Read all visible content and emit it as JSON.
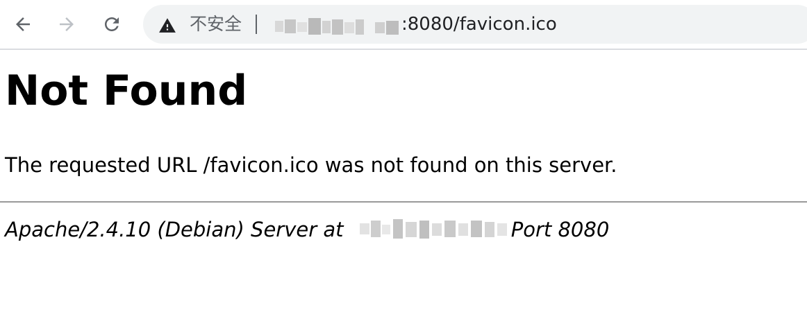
{
  "browser": {
    "back_icon": "arrow-left-icon",
    "forward_icon": "arrow-right-icon",
    "reload_icon": "reload-icon",
    "security_icon": "warning-triangle-icon",
    "security_label": "不安全",
    "url_visible_suffix": ":8080/favicon.ico"
  },
  "page": {
    "heading": "Not Found",
    "message": "The requested URL /favicon.ico was not found on this server.",
    "server_prefix": "Apache/2.4.10 (Debian) Server at",
    "server_suffix": "Port 8080"
  },
  "colors": {
    "omnibox_bg": "#f1f3f4",
    "icon_gray": "#5f6368",
    "text": "#000000",
    "rule": "#9e9e9e"
  }
}
